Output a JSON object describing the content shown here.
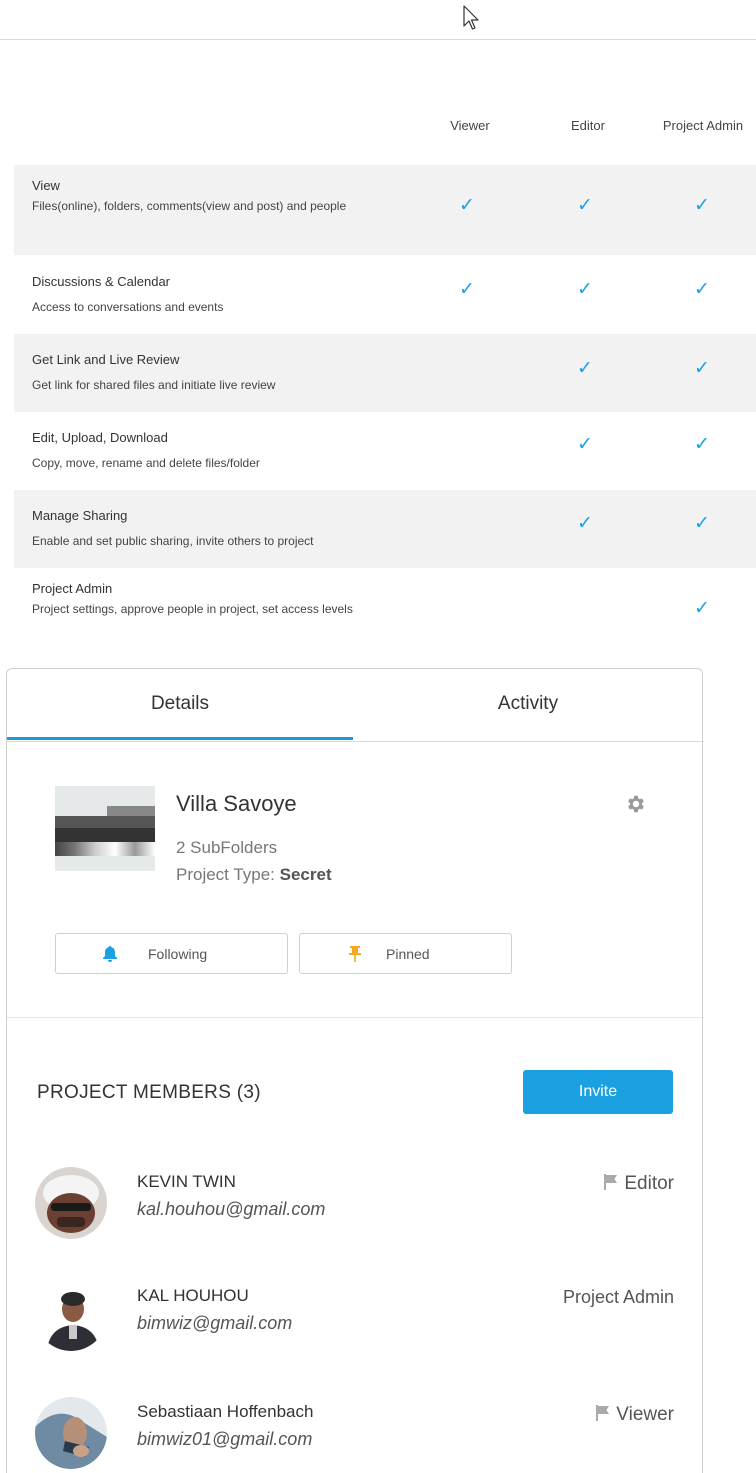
{
  "permissions": {
    "columns": [
      "Viewer",
      "Editor",
      "Project Admin"
    ],
    "check_color": "#1ba1e2",
    "rows": [
      {
        "title": "View",
        "desc": "Files(online), folders, comments(view and post) and people",
        "viewer": true,
        "editor": true,
        "admin": true
      },
      {
        "title": "Discussions & Calendar",
        "desc": "Access to conversations and events",
        "viewer": true,
        "editor": true,
        "admin": true
      },
      {
        "title": "Get Link and Live Review",
        "desc": "Get link for shared files and initiate live review",
        "viewer": false,
        "editor": true,
        "admin": true
      },
      {
        "title": "Edit, Upload, Download",
        "desc": "Copy, move, rename and delete files/folder",
        "viewer": false,
        "editor": true,
        "admin": true
      },
      {
        "title": "Manage Sharing",
        "desc": "Enable and set public sharing, invite others to project",
        "viewer": false,
        "editor": true,
        "admin": true
      },
      {
        "title": "Project Admin",
        "desc": "Project settings, approve people in project, set access levels",
        "viewer": false,
        "editor": false,
        "admin": true
      }
    ]
  },
  "panel": {
    "tabs": {
      "details": "Details",
      "activity": "Activity"
    },
    "project": {
      "name": "Villa Savoye",
      "subfolders": "2 SubFolders",
      "type_label": "Project Type:",
      "type_value": "Secret"
    },
    "following_label": "Following",
    "pinned_label": "Pinned",
    "members_title": "PROJECT MEMBERS (3)",
    "invite_label": "Invite",
    "accent": "#1ba1e2",
    "members": [
      {
        "name": "KEVIN TWIN",
        "email": "kal.houhou@gmail.com",
        "role": "Editor",
        "flag": true
      },
      {
        "name": "KAL HOUHOU",
        "email": "bimwiz@gmail.com",
        "role": "Project Admin",
        "flag": false
      },
      {
        "name": "Sebastiaan Hoffenbach",
        "email": "bimwiz01@gmail.com",
        "role": "Viewer",
        "flag": true
      }
    ]
  }
}
